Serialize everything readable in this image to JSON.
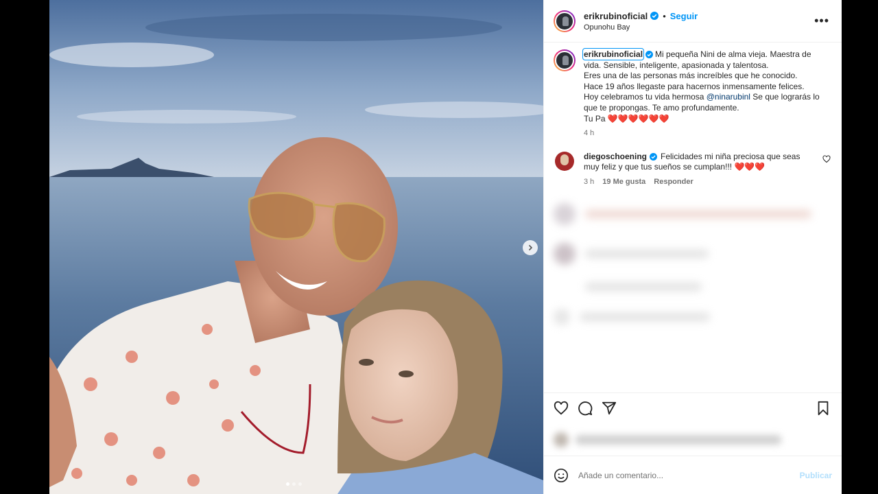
{
  "post": {
    "username": "erikrubinoficial",
    "follow_label": "Seguir",
    "separator": "•",
    "location": "Opunohu Bay",
    "more_label": "•••"
  },
  "caption": {
    "username": "erikrubinoficial",
    "text_1": "Mi pequeña Nini de alma vieja. Maestra de vida. Sensible, inteligente, apasionada y talentosa.",
    "text_2": "Eres una de las personas más increíbles que he conocido.",
    "text_3": "Hace 19 años llegaste para hacernos inmensamente felices.",
    "text_4a": "Hoy celebramos tu vida hermosa ",
    "mention": "@ninarubinl",
    "text_4b": " Se que lograrás lo que te propongas. Te amo profundamente.",
    "signoff": "Tu Pa ❤️❤️❤️❤️❤️❤️",
    "time": "4 h"
  },
  "comment": {
    "username": "diegoschoening",
    "text": "Felicidades mi niña preciosa que seas muy feliz y que tus sueños se cumplan!!! ❤️❤️❤️",
    "time": "3 h",
    "likes": "19 Me gusta",
    "reply": "Responder"
  },
  "add_comment": {
    "placeholder": "Añade un comentario...",
    "publish": "Publicar"
  },
  "icons": {
    "verified": "verified-badge-icon",
    "next": "chevron-right-icon",
    "like": "heart-icon",
    "comment": "comment-icon",
    "share": "share-icon",
    "save": "bookmark-icon",
    "emoji": "emoji-icon"
  },
  "colors": {
    "accent": "#0095f6",
    "verified": "#0095f6",
    "publish_disabled": "#b2dffc"
  },
  "carousel": {
    "slides": 3,
    "active": 1
  }
}
